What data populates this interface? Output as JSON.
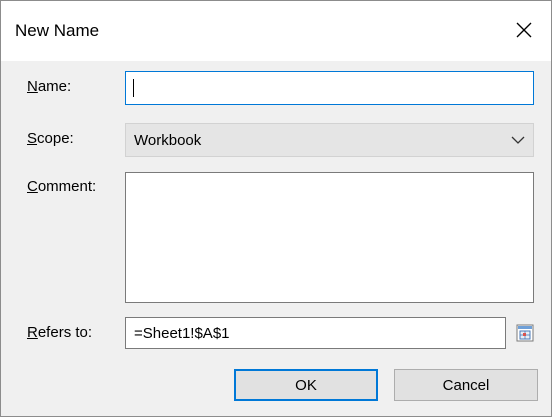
{
  "dialog": {
    "title": "New Name",
    "close_icon": "close-icon"
  },
  "fields": {
    "name": {
      "label_accel": "N",
      "label_rest": "ame:",
      "value": ""
    },
    "scope": {
      "label_accel": "S",
      "label_rest": "cope:",
      "selected": "Workbook",
      "chevron_icon": "chevron-down-icon"
    },
    "comment": {
      "label_accel": "C",
      "label_rest": "omment:",
      "value": ""
    },
    "refers_to": {
      "label_accel": "R",
      "label_rest": "efers to:",
      "value": "=Sheet1!$A$1",
      "collapse_icon": "range-select-icon"
    }
  },
  "buttons": {
    "ok": "OK",
    "cancel": "Cancel"
  },
  "colors": {
    "focus_accent": "#0078d7",
    "dialog_bg": "#f0f0f0"
  }
}
